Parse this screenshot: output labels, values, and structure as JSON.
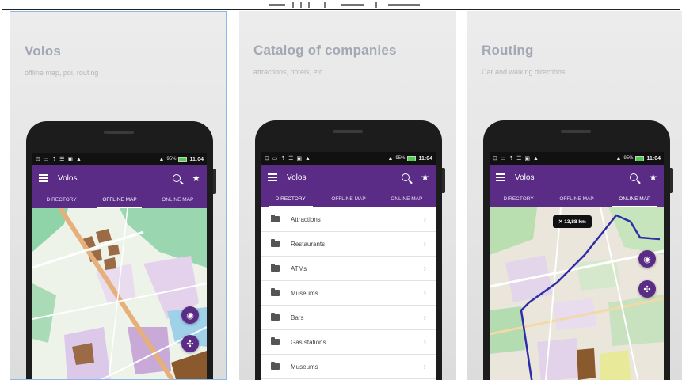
{
  "colors": {
    "purple": "#5b2c86",
    "title_gray": "#a3a8b4"
  },
  "screens": [
    {
      "title": "Volos",
      "subtitle": "offline map, poi, routing",
      "status": {
        "left": "⊡ ▭ ⇡ ☰ ▣ ▲",
        "pct": "95%",
        "time": "11:04"
      },
      "appbar_title": "Volos",
      "tabs": [
        "DIRECTORY",
        "OFFLINE MAP",
        "ONLINE MAP"
      ],
      "active_tab": "OFFLINE MAP"
    },
    {
      "title": "Catalog of companies",
      "subtitle": "attractions, hotels, etc.",
      "status": {
        "left": "⊡ ▭ ⇡ ☰ ▣ ▲",
        "pct": "95%",
        "time": "11:04"
      },
      "appbar_title": "Volos",
      "tabs": [
        "DIRECTORY",
        "OFFLINE MAP",
        "ONLINE MAP"
      ],
      "active_tab": "DIRECTORY",
      "list": [
        "Attractions",
        "Restaurants",
        "ATMs",
        "Museums",
        "Bars",
        "Gas stations",
        "Museums"
      ]
    },
    {
      "title": "Routing",
      "subtitle": "Car and walking directions",
      "status": {
        "left": "⊡ ▭ ⇡ ☰ ▣ ▲",
        "pct": "95%",
        "time": "11:04"
      },
      "appbar_title": "Volos",
      "tabs": [
        "DIRECTORY",
        "OFFLINE MAP",
        "ONLINE MAP"
      ],
      "active_tab": "ONLINE MAP",
      "distance": "13,88 km"
    }
  ],
  "icons": {
    "menu": "menu-icon",
    "search": "search-icon",
    "star": "star-icon",
    "folder": "folder-icon",
    "locate": "locate-icon",
    "move": "move-icon",
    "close": "close-icon"
  }
}
